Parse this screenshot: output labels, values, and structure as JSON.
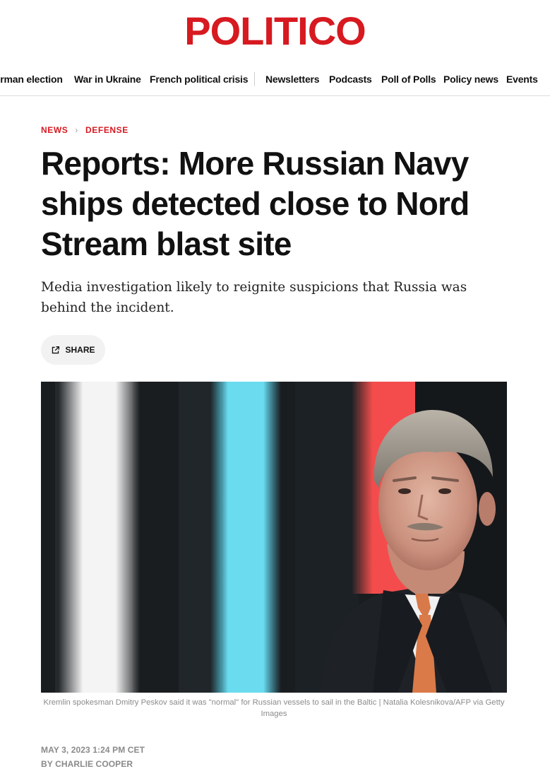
{
  "logo": {
    "text": "POLITICO"
  },
  "nav": {
    "items": [
      {
        "label": "German election"
      },
      {
        "label": "War in Ukraine"
      },
      {
        "label": "French political crisis"
      },
      {
        "label": "Newsletters"
      },
      {
        "label": "Podcasts"
      },
      {
        "label": "Poll of Polls"
      },
      {
        "label": "Policy news"
      },
      {
        "label": "Events"
      }
    ]
  },
  "breadcrumb": {
    "section": "NEWS",
    "subsection": "DEFENSE"
  },
  "article": {
    "headline": "Reports: More Russian Navy ships detected close to Nord Stream blast site",
    "dek": "Media investigation likely to reignite suspicions that Russia was behind the incident.",
    "share_label": "SHARE",
    "caption": "Kremlin spokesman Dmitry Peskov said it was \"normal\" for Russian vessels to sail in the Baltic | Natalia Kolesnikova/AFP via Getty Images",
    "date": "MAY 3, 2023 1:24 PM CET",
    "byline": "BY CHARLIE COOPER"
  },
  "colors": {
    "brand": "#d71920",
    "text": "#111111",
    "muted": "#8a8a8a"
  },
  "icons": {
    "share": "share-external-icon",
    "chevron": "chevron-right-icon"
  }
}
